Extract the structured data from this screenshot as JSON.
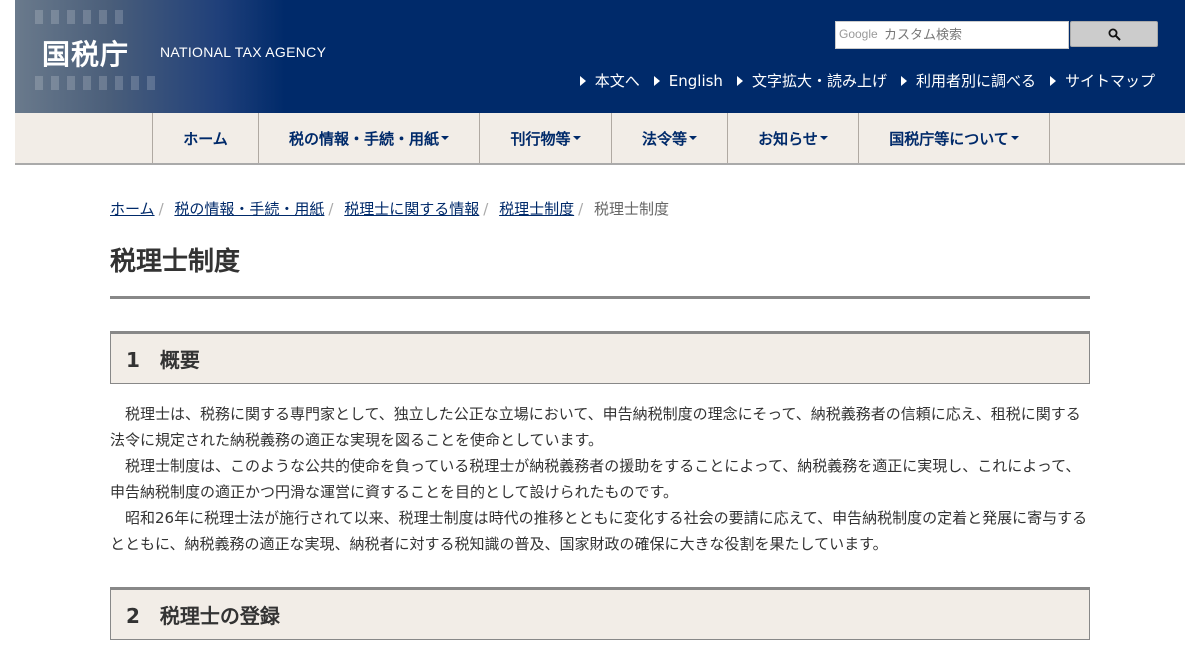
{
  "header": {
    "logo": "国税庁",
    "logo_en": "NATIONAL TAX AGENCY",
    "search": {
      "placeholder": "カスタム検索",
      "brand": "Google"
    },
    "util_links": [
      "本文へ",
      "English",
      "文字拡大・読み上げ",
      "利用者別に調べる",
      "サイトマップ"
    ]
  },
  "nav": {
    "items": [
      {
        "label": "ホーム",
        "dropdown": false
      },
      {
        "label": "税の情報・手続・用紙",
        "dropdown": true
      },
      {
        "label": "刊行物等",
        "dropdown": true
      },
      {
        "label": "法令等",
        "dropdown": true
      },
      {
        "label": "お知らせ",
        "dropdown": true
      },
      {
        "label": "国税庁等について",
        "dropdown": true
      }
    ]
  },
  "breadcrumb": {
    "links": [
      "ホーム",
      "税の情報・手続・用紙",
      "税理士に関する情報",
      "税理士制度"
    ],
    "current": "税理士制度"
  },
  "page_title": "税理士制度",
  "sections": [
    {
      "heading": "1　概要",
      "paragraphs": [
        "税理士は、税務に関する専門家として、独立した公正な立場において、申告納税制度の理念にそって、納税義務者の信頼に応え、租税に関する法令に規定された納税義務の適正な実現を図ることを使命としています。",
        "税理士制度は、このような公共的使命を負っている税理士が納税義務者の援助をすることによって、納税義務を適正に実現し、これによって、申告納税制度の適正かつ円滑な運営に資することを目的として設けられたものです。",
        "昭和26年に税理士法が施行されて以来、税理士制度は時代の推移とともに変化する社会の要請に応えて、申告納税制度の定着と発展に寄与するとともに、納税義務の適正な実現、納税者に対する税知識の普及、国家財政の確保に大きな役割を果たしています。"
      ]
    },
    {
      "heading": "2　税理士の登録",
      "paragraphs": []
    }
  ],
  "colors": {
    "header_bg": "#002a6a",
    "nav_bg": "#f2ede7",
    "section_bg": "#f2ede7",
    "link": "#002a6a"
  },
  "icons": [
    "search-icon",
    "triangle-right-icon",
    "caret-down-icon"
  ]
}
